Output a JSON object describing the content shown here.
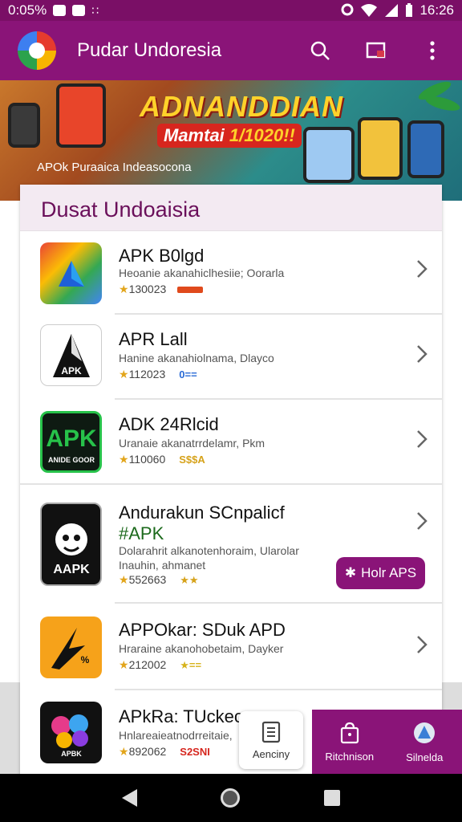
{
  "status_bar": {
    "time_left": "0:05%",
    "clock": "16:26"
  },
  "app_bar": {
    "title": "Pudar Undoresia"
  },
  "banner": {
    "headline": "ADNANDDIAN",
    "sub_prefix": "Mamtai ",
    "sub_accent": "1/1020!!",
    "caption": "APOk Puraaica Indeasocona"
  },
  "card": {
    "title": "Dusat Undoaisia",
    "apps": [
      {
        "name": "APK B0lgd",
        "name_extra": "",
        "desc": "Heoanie akanahiclhesiie; Oorarla",
        "desc2": "",
        "rating": "130023",
        "tag": "",
        "tag_color": "#e04a1c"
      },
      {
        "name": "APR Lall",
        "name_extra": "",
        "desc": "Hanine akanahiolnama, Dlayco",
        "desc2": "",
        "rating": "112023",
        "tag": "0==",
        "tag_color": "#2a6bd6"
      },
      {
        "name": "ADK 24Rlcid",
        "name_extra": "",
        "desc": "Uranaie akanatrrdelamr, Pkm",
        "desc2": "",
        "rating": "110060",
        "tag": "S$$A",
        "tag_color": "#d6a21a"
      },
      {
        "name": "Andurakun SCnpalicf",
        "name_extra": "#APK",
        "desc": "Dolarahrit alkanotenhoraim, Ularolar",
        "desc2": "Inauhin, ahmanet",
        "rating": "552663",
        "tag": "★★",
        "tag_color": "#d6a21a"
      },
      {
        "name": "APPOkar: SDuk APD",
        "name_extra": "",
        "desc": "Hraraine akanohobetaim, Dayker",
        "desc2": "",
        "rating": "212002",
        "tag": "★==",
        "tag_color": "#d6b21a"
      },
      {
        "name": "APkRa: TUckec",
        "name_extra": "",
        "desc": "Hnlareaieatnodrreitaie,",
        "desc2": "",
        "rating": "892062",
        "tag": "S2SNI",
        "tag_color": "#d6261e"
      }
    ],
    "hot_button": "Holr APS"
  },
  "float_button": {
    "label": "Aenciny"
  },
  "bottom_nav": {
    "item1": "Ritchnison",
    "item2": "Silnelda"
  },
  "colors": {
    "primary": "#8a1478",
    "accent": "#ffd22a"
  },
  "icons": [
    "search-icon",
    "window-icon",
    "more-vert-icon",
    "chevron-right-icon",
    "star-icon",
    "sparkle-icon",
    "document-icon",
    "bag-icon",
    "store-icon"
  ]
}
